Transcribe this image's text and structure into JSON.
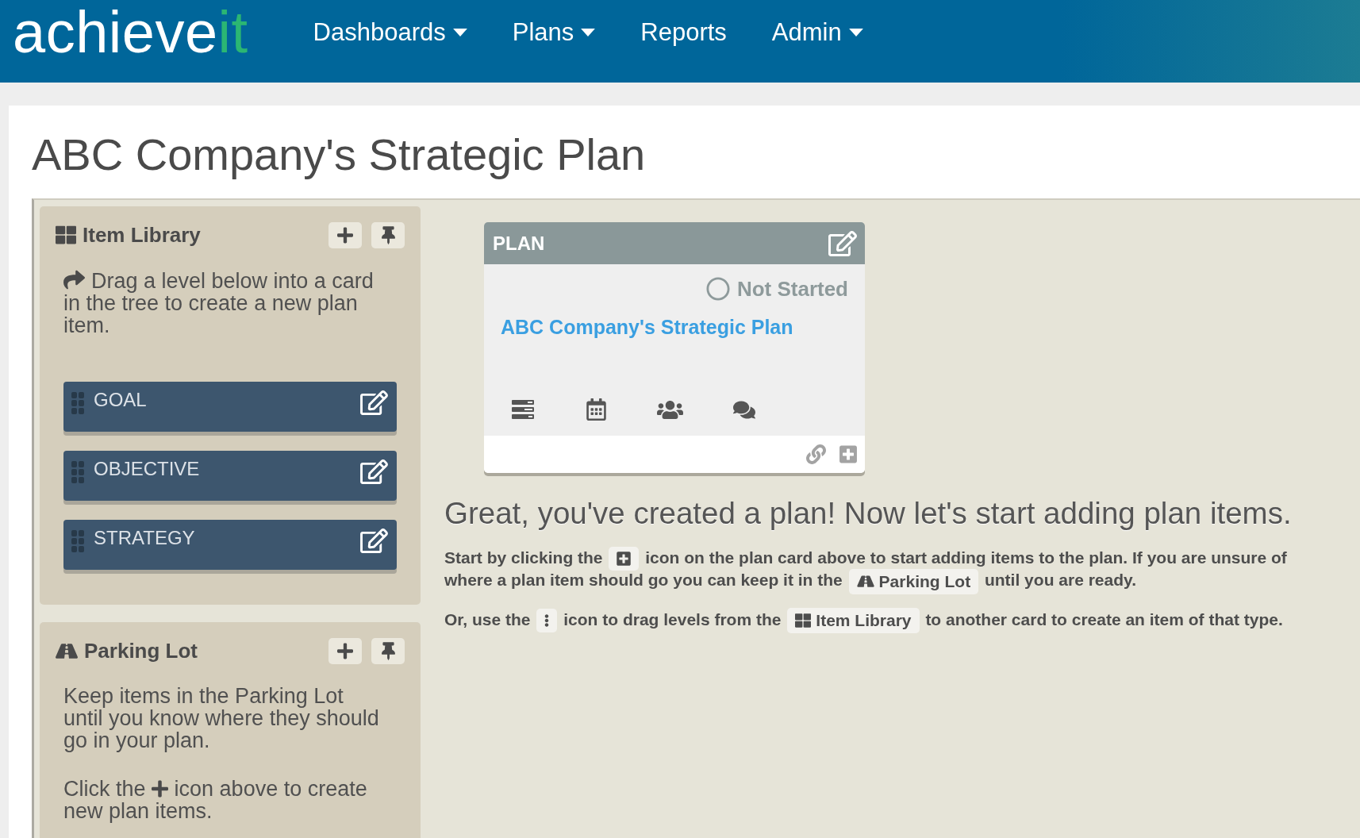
{
  "header": {
    "logo": {
      "text": "achieve",
      "accent": "it"
    },
    "nav": [
      {
        "label": "Dashboards",
        "has_menu": true
      },
      {
        "label": "Plans",
        "has_menu": true
      },
      {
        "label": "Reports",
        "has_menu": false
      },
      {
        "label": "Admin",
        "has_menu": true
      }
    ]
  },
  "page": {
    "title": "ABC Company's Strategic Plan"
  },
  "sidebar": {
    "panels": [
      {
        "kind": "library",
        "title": "Item Library",
        "paragraphs": [
          {
            "segments": [
              {
                "kind": "text",
                "text": "Drag a level below into a card in the tree to create a new plan item."
              }
            ]
          }
        ],
        "levels": [
          {
            "label": "GOAL"
          },
          {
            "label": "OBJECTIVE"
          },
          {
            "label": "STRATEGY"
          }
        ]
      },
      {
        "kind": "parking",
        "title": "Parking Lot",
        "paragraphs": [
          {
            "segments": [
              {
                "kind": "text",
                "text": "Keep items in the Parking Lot until you know where they should go in your plan."
              }
            ]
          },
          {
            "segments": [
              {
                "kind": "text",
                "text": "Click the"
              },
              {
                "kind": "add"
              },
              {
                "kind": "text",
                "text": "icon above to create new plan items."
              }
            ]
          }
        ]
      }
    ]
  },
  "plan_card": {
    "type": "PLAN",
    "status": "Not Started",
    "title": "ABC Company's Strategic Plan"
  },
  "intro": {
    "heading": "Great, you've created a plan! Now let's start adding plan items.",
    "paragraphs": [
      {
        "segments": [
          {
            "kind": "text",
            "text": "Start by clicking the"
          },
          {
            "kind": "add"
          },
          {
            "kind": "text",
            "text": "icon on the plan card above to start adding items to the plan. If you are unsure of where a plan item should go you can keep it in the"
          },
          {
            "kind": "parking",
            "text": "Parking Lot"
          },
          {
            "kind": "text",
            "text": "until you are ready."
          }
        ]
      },
      {
        "segments": [
          {
            "kind": "text",
            "text": "Or, use the"
          },
          {
            "kind": "drag"
          },
          {
            "kind": "text",
            "text": "icon to drag levels from the"
          },
          {
            "kind": "library",
            "text": "Item Library"
          },
          {
            "kind": "text",
            "text": "to another card to create an item of that type."
          }
        ]
      }
    ]
  }
}
